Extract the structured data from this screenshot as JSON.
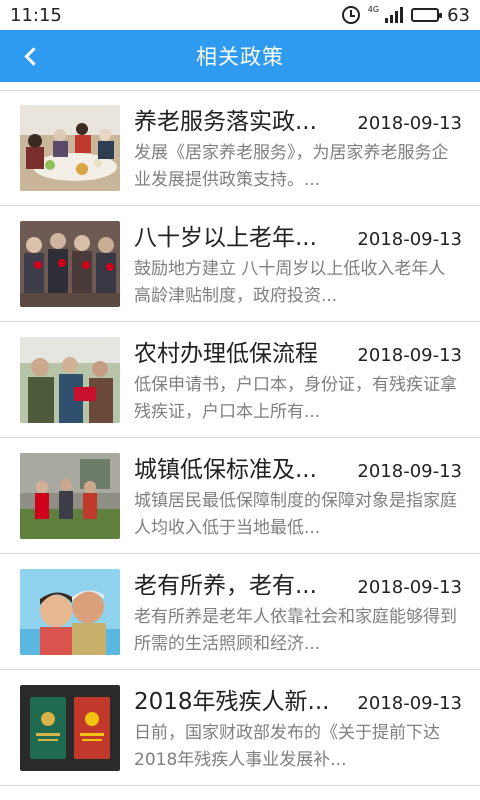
{
  "status": {
    "time": "11:15",
    "network": "4G",
    "battery": "63",
    "battery_level": 0.63
  },
  "header": {
    "title": "相关政策"
  },
  "items": [
    {
      "title": "养老服务落实政...",
      "date": "2018-09-13",
      "summary": "发展《居家养老服务》，为居家养老服务企业发展提供政策支持。..."
    },
    {
      "title": "八十岁以上老年...",
      "date": "2018-09-13",
      "summary": "鼓励地方建立 八十周岁以上低收入老年人 高龄津贴制度，政府投资..."
    },
    {
      "title": "农村办理低保流程",
      "date": "2018-09-13",
      "summary": "低保申请书，户口本，身份证，有残疾证拿残疾证，户口本上所有..."
    },
    {
      "title": "城镇低保标准及...",
      "date": "2018-09-13",
      "summary": "城镇居民最低保障制度的保障对象是指家庭人均收入低于当地最低..."
    },
    {
      "title": "老有所养，老有...",
      "date": "2018-09-13",
      "summary": "老有所养是老年人依靠社会和家庭能够得到所需的生活照顾和经济..."
    },
    {
      "title": "2018年残疾人新...",
      "date": "2018-09-13",
      "summary": "日前，国家财政部发布的《关于提前下达2018年残疾人事业发展补..."
    }
  ]
}
